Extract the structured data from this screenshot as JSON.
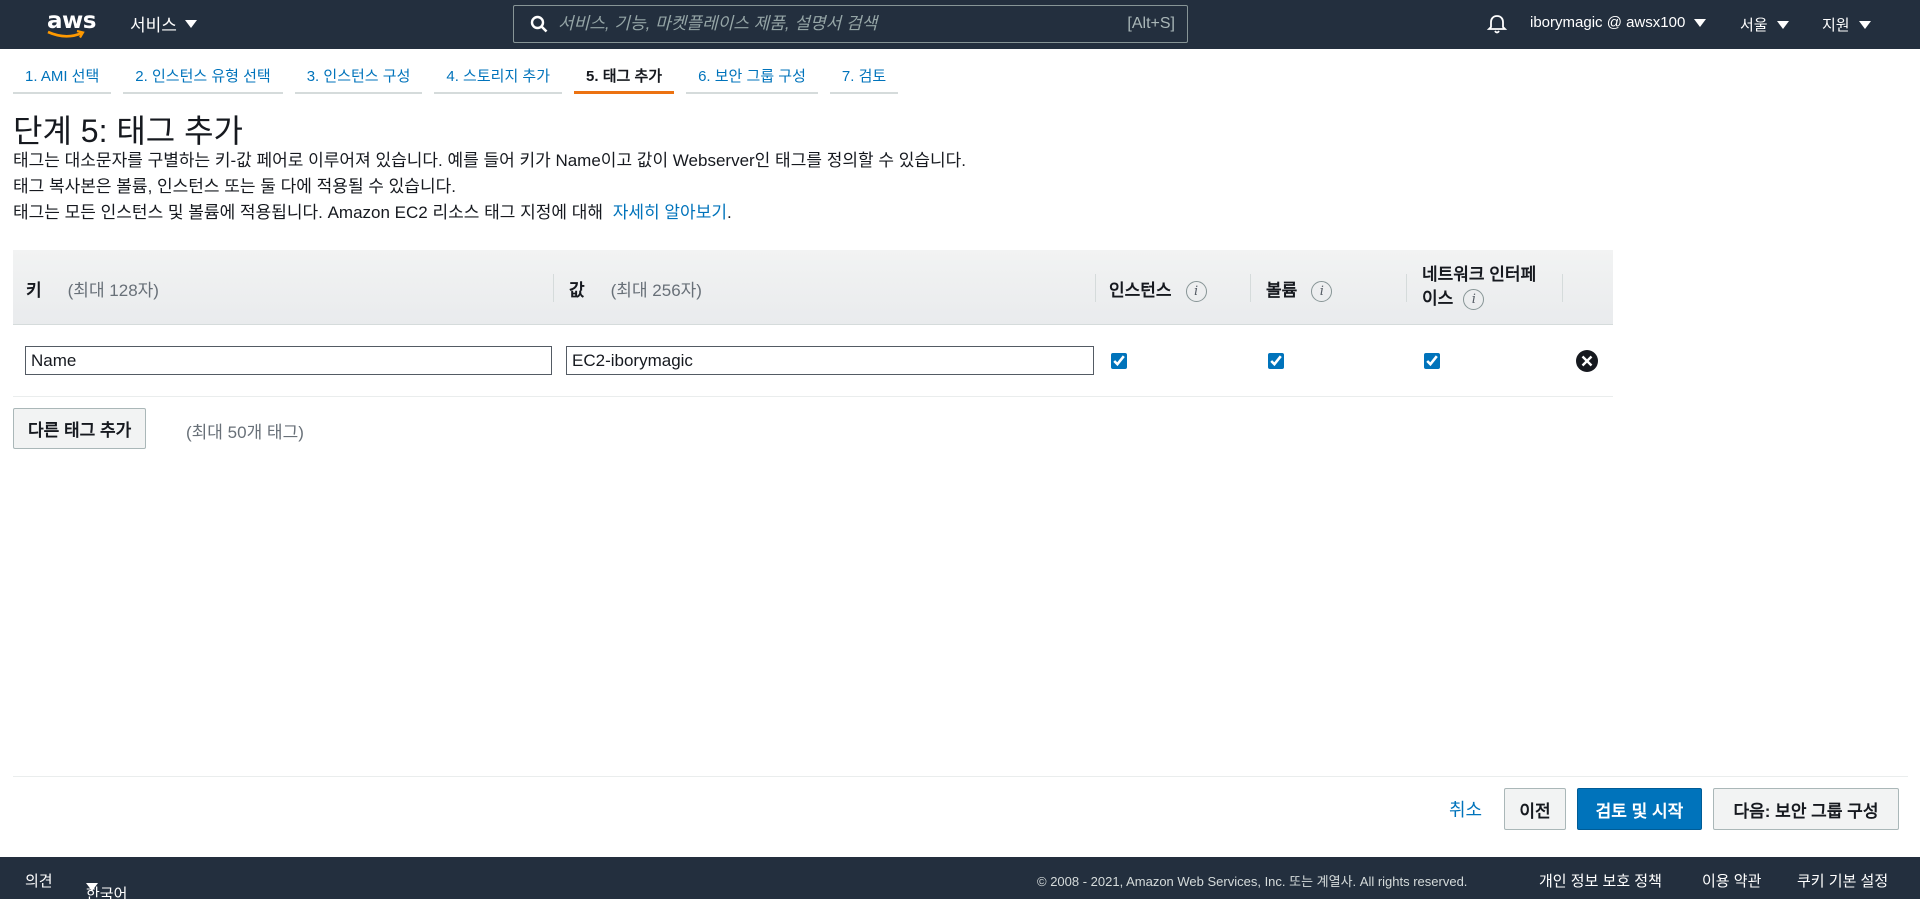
{
  "nav": {
    "logo": "aws",
    "services_label": "서비스",
    "search_placeholder": "서비스, 기능, 마켓플레이스 제품, 설명서 검색",
    "search_shortcut": "[Alt+S]",
    "account_label": "iborymagic @ awsx100",
    "region_label": "서울",
    "support_label": "지원"
  },
  "wizard": {
    "tabs": [
      {
        "label": "1. AMI 선택"
      },
      {
        "label": "2. 인스턴스 유형 선택"
      },
      {
        "label": "3. 인스턴스 구성"
      },
      {
        "label": "4. 스토리지 추가"
      },
      {
        "label": "5. 태그 추가"
      },
      {
        "label": "6. 보안 그룹 구성"
      },
      {
        "label": "7. 검토"
      }
    ],
    "active_index": 4
  },
  "page": {
    "title": "단계 5: 태그 추가",
    "desc1": "태그는 대소문자를 구별하는 키-값 페어로 이루어져 있습니다. 예를 들어 키가 Name이고 값이 Webserver인 태그를 정의할 수 있습니다.",
    "desc2": "태그 복사본은 볼륨, 인스턴스 또는 둘 다에 적용될 수 있습니다.",
    "desc3": "태그는 모든 인스턴스 및 볼륨에 적용됩니다. Amazon EC2 리소스 태그 지정에 대해",
    "learn_more": "자세히 알아보기",
    "desc3_end": "."
  },
  "table": {
    "key_header": "키",
    "key_hint": "(최대 128자)",
    "value_header": "값",
    "value_hint": "(최대 256자)",
    "instance_header": "인스턴스",
    "volume_header": "볼륨",
    "network_header_line1": "네트워크 인터페",
    "network_header_line2": "이스",
    "info_glyph": "i",
    "rows": [
      {
        "key": "Name",
        "value": "EC2-iborymagic",
        "instance": true,
        "volume": true,
        "network": true
      }
    ]
  },
  "add_tag": {
    "button_label": "다른 태그 추가",
    "hint": "(최대 50개 태그)"
  },
  "actions": {
    "cancel": "취소",
    "previous": "이전",
    "review_launch": "검토 및 시작",
    "next": "다음: 보안 그룹 구성"
  },
  "footer": {
    "feedback": "의견",
    "language": "한국어",
    "copyright": "© 2008 - 2021, Amazon Web Services, Inc. 또는 계열사. All rights reserved.",
    "privacy": "개인 정보 보호 정책",
    "terms": "이용 약관",
    "cookies": "쿠키 기본 설정"
  },
  "colors": {
    "nav_bg": "#232f3e",
    "link": "#0073bb",
    "active_tab": "#ec7211",
    "primary_button": "#0073bb"
  }
}
